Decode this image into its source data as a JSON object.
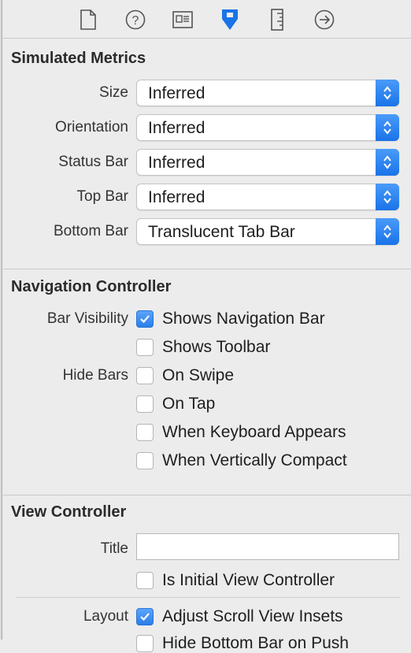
{
  "toolbar": {
    "icons": [
      "file-inspector-icon",
      "quick-help-icon",
      "identity-inspector-icon",
      "attributes-inspector-icon",
      "size-inspector-icon",
      "connections-inspector-icon"
    ]
  },
  "simulated_metrics": {
    "title": "Simulated Metrics",
    "rows": [
      {
        "label": "Size",
        "value": "Inferred"
      },
      {
        "label": "Orientation",
        "value": "Inferred"
      },
      {
        "label": "Status Bar",
        "value": "Inferred"
      },
      {
        "label": "Top Bar",
        "value": "Inferred"
      },
      {
        "label": "Bottom Bar",
        "value": "Translucent Tab Bar"
      }
    ]
  },
  "navigation_controller": {
    "title": "Navigation Controller",
    "bar_visibility_label": "Bar Visibility",
    "hide_bars_label": "Hide Bars",
    "options": [
      {
        "label": "Shows Navigation Bar",
        "checked": true
      },
      {
        "label": "Shows Toolbar",
        "checked": false
      },
      {
        "label": "On Swipe",
        "checked": false
      },
      {
        "label": "On Tap",
        "checked": false
      },
      {
        "label": "When Keyboard Appears",
        "checked": false
      },
      {
        "label": "When Vertically Compact",
        "checked": false
      }
    ]
  },
  "view_controller": {
    "title": "View Controller",
    "title_label": "Title",
    "title_value": "",
    "initial_label": "Is Initial View Controller",
    "initial_checked": false,
    "layout_label": "Layout",
    "adjust_label": "Adjust Scroll View Insets",
    "adjust_checked": true,
    "hide_bottom_label": "Hide Bottom Bar on Push"
  },
  "colors": {
    "accent": "#1a73e8"
  }
}
